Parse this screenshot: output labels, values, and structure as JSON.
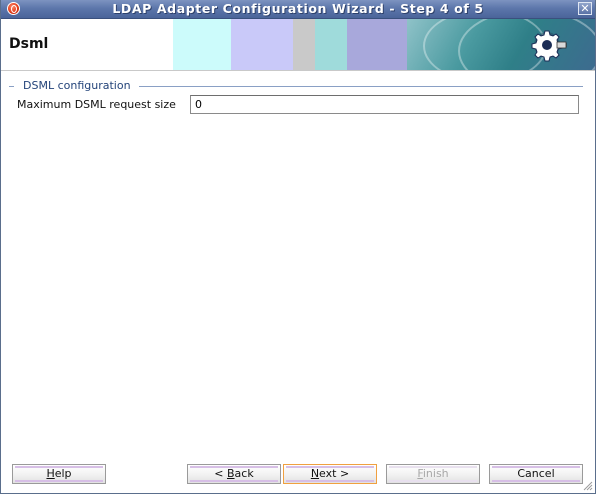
{
  "window": {
    "title": "LDAP Adapter Configuration Wizard - Step 4 of 5",
    "close_label": "✕"
  },
  "header": {
    "page_title": "Dsml"
  },
  "section": {
    "legend": "DSML configuration",
    "field_label": "Maximum DSML request size",
    "field_value": "0"
  },
  "buttons": {
    "help": {
      "mnemonic": "H",
      "rest": "elp"
    },
    "back": {
      "prefix": "< ",
      "mnemonic": "B",
      "rest": "ack"
    },
    "next": {
      "mnemonic": "N",
      "rest": "ext >"
    },
    "finish": {
      "mnemonic": "F",
      "rest": "inish"
    },
    "cancel": {
      "label": "Cancel"
    }
  },
  "colors": {
    "titlebar": "#5d77ab",
    "legend_text": "#24447a",
    "default_button_border": "#f0a040"
  },
  "icons": [
    "app-icon",
    "close-icon",
    "gear-plug-icon",
    "resize-grip-icon"
  ]
}
